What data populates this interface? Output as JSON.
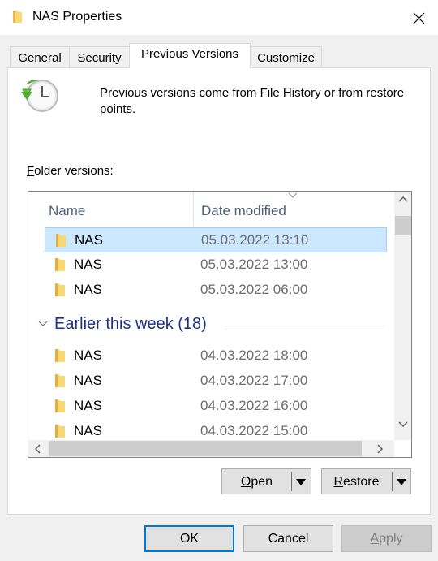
{
  "window": {
    "title": "NAS Properties",
    "close_icon": "close-icon"
  },
  "tabs": [
    {
      "label": "General",
      "active": false
    },
    {
      "label": "Security",
      "active": false
    },
    {
      "label": "Previous Versions",
      "active": true
    },
    {
      "label": "Customize",
      "active": false
    }
  ],
  "panel": {
    "icon": "previous-versions-clock-icon",
    "description": "Previous versions come from File History or from restore points.",
    "folder_versions_label_accel": "F",
    "folder_versions_label_rest": "older versions:"
  },
  "list": {
    "columns": [
      "Name",
      "Date modified"
    ],
    "recent_rows": [
      {
        "name": "NAS",
        "date": "05.03.2022 13:10",
        "selected": true
      },
      {
        "name": "NAS",
        "date": "05.03.2022 13:00",
        "selected": false
      },
      {
        "name": "NAS",
        "date": "05.03.2022 06:00",
        "selected": false
      }
    ],
    "group": {
      "label": "Earlier this week (18)",
      "expanded": true
    },
    "group_rows": [
      {
        "name": "NAS",
        "date": "04.03.2022 18:00"
      },
      {
        "name": "NAS",
        "date": "04.03.2022 17:00"
      },
      {
        "name": "NAS",
        "date": "04.03.2022 16:00"
      },
      {
        "name": "NAS",
        "date": "04.03.2022 15:00"
      }
    ]
  },
  "actions": {
    "open_accel": "O",
    "open_rest": "pen",
    "restore_accel": "R",
    "restore_rest": "estore"
  },
  "footer": {
    "ok": "OK",
    "cancel": "Cancel",
    "apply_accel": "A",
    "apply_rest": "pply",
    "apply_enabled": false
  },
  "colors": {
    "accent": "#0078d7",
    "selection": "#cce8ff",
    "group_header": "#1e3287"
  }
}
